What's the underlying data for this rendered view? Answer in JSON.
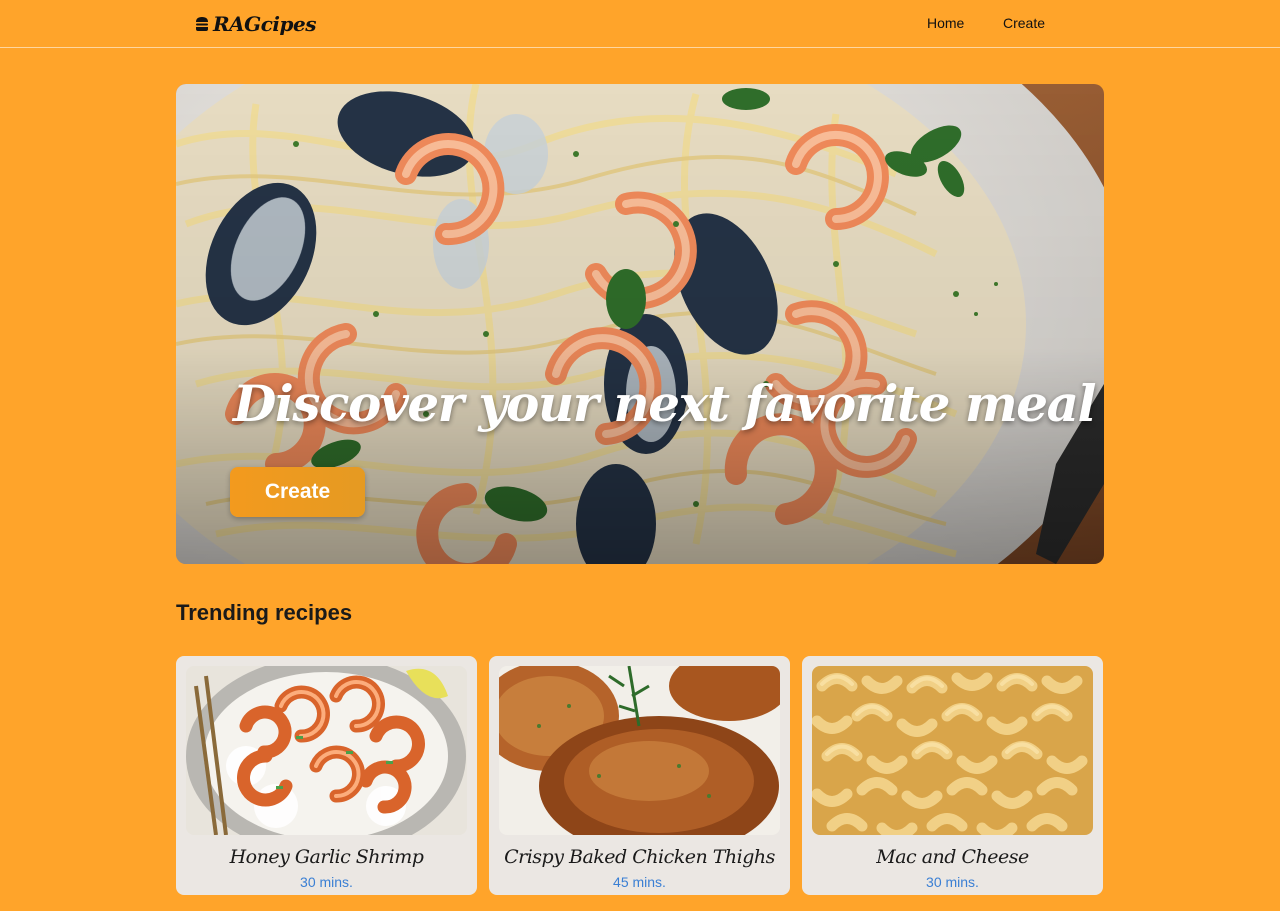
{
  "navbar": {
    "brand": "RAGcipes",
    "brand_icon": "burger-icon",
    "links": [
      "Home",
      "Create"
    ]
  },
  "hero": {
    "headline": "Discover your next favorite meal",
    "button_label": "Create",
    "image": "seafood-pasta-photo"
  },
  "trending": {
    "title": "Trending recipes",
    "recipes": [
      {
        "title": "Honey Garlic Shrimp",
        "time": "30 mins.",
        "image": "shrimp-rice-photo"
      },
      {
        "title": "Crispy Baked Chicken Thighs",
        "time": "45 mins.",
        "image": "chicken-thighs-photo"
      },
      {
        "title": "Mac and Cheese",
        "time": "30 mins.",
        "image": "mac-and-cheese-photo"
      }
    ]
  },
  "colors": {
    "background": "#ffa42a",
    "card": "#ebe7e3",
    "button": "#f39a1e",
    "time_text": "#3a7fd4"
  }
}
